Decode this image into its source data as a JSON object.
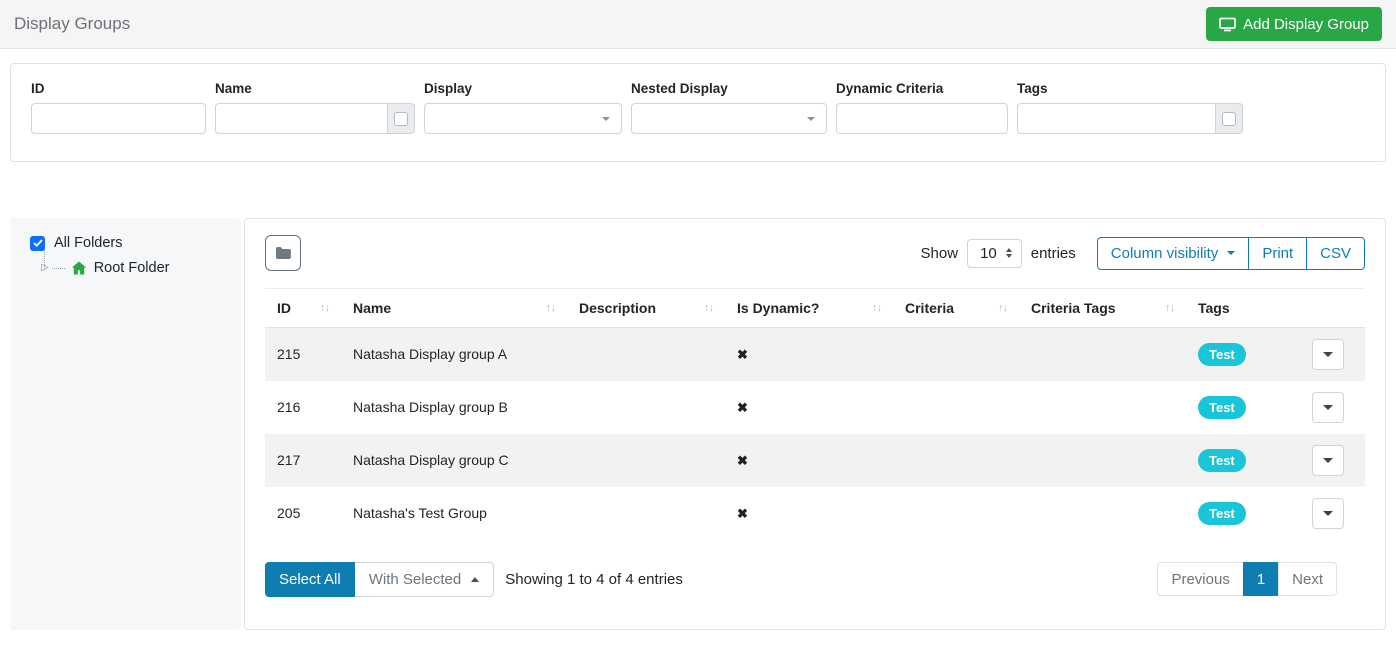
{
  "header": {
    "title": "Display Groups",
    "add_button_label": "Add Display Group"
  },
  "filters": {
    "id": {
      "label": "ID",
      "value": ""
    },
    "name": {
      "label": "Name",
      "value": ""
    },
    "display": {
      "label": "Display",
      "value": ""
    },
    "nested_display": {
      "label": "Nested Display",
      "value": ""
    },
    "dynamic_criteria": {
      "label": "Dynamic Criteria",
      "value": ""
    },
    "tags": {
      "label": "Tags",
      "value": ""
    }
  },
  "sidebar": {
    "all_folders_label": "All Folders",
    "root_folder_label": "Root Folder"
  },
  "table": {
    "show_label": "Show",
    "page_length": "10",
    "entries_label": "entries",
    "buttons": {
      "column_visibility": "Column visibility",
      "print": "Print",
      "csv": "CSV"
    },
    "columns": [
      "ID",
      "Name",
      "Description",
      "Is Dynamic?",
      "Criteria",
      "Criteria Tags",
      "Tags"
    ],
    "rows": [
      {
        "id": "215",
        "name": "Natasha Display group A",
        "description": "",
        "criteria": "",
        "criteria_tags": "",
        "tag": "Test"
      },
      {
        "id": "216",
        "name": "Natasha Display group B",
        "description": "",
        "criteria": "",
        "criteria_tags": "",
        "tag": "Test"
      },
      {
        "id": "217",
        "name": "Natasha Display group C",
        "description": "",
        "criteria": "",
        "criteria_tags": "",
        "tag": "Test"
      },
      {
        "id": "205",
        "name": "Natasha's Test Group",
        "description": "",
        "criteria": "",
        "criteria_tags": "",
        "tag": "Test"
      }
    ],
    "footer": {
      "select_all_label": "Select All",
      "with_selected_label": "With Selected",
      "showing_text": "Showing 1 to 4 of 4 entries"
    },
    "pagination": {
      "previous": "Previous",
      "current": "1",
      "next": "Next"
    }
  },
  "icons": {
    "is_dynamic_false": "✖",
    "sort": "↑↓",
    "tree_expander": "▷"
  },
  "colors": {
    "primary": "#0e7db2",
    "success": "#28a745",
    "tag_badge": "#18c5d9"
  }
}
